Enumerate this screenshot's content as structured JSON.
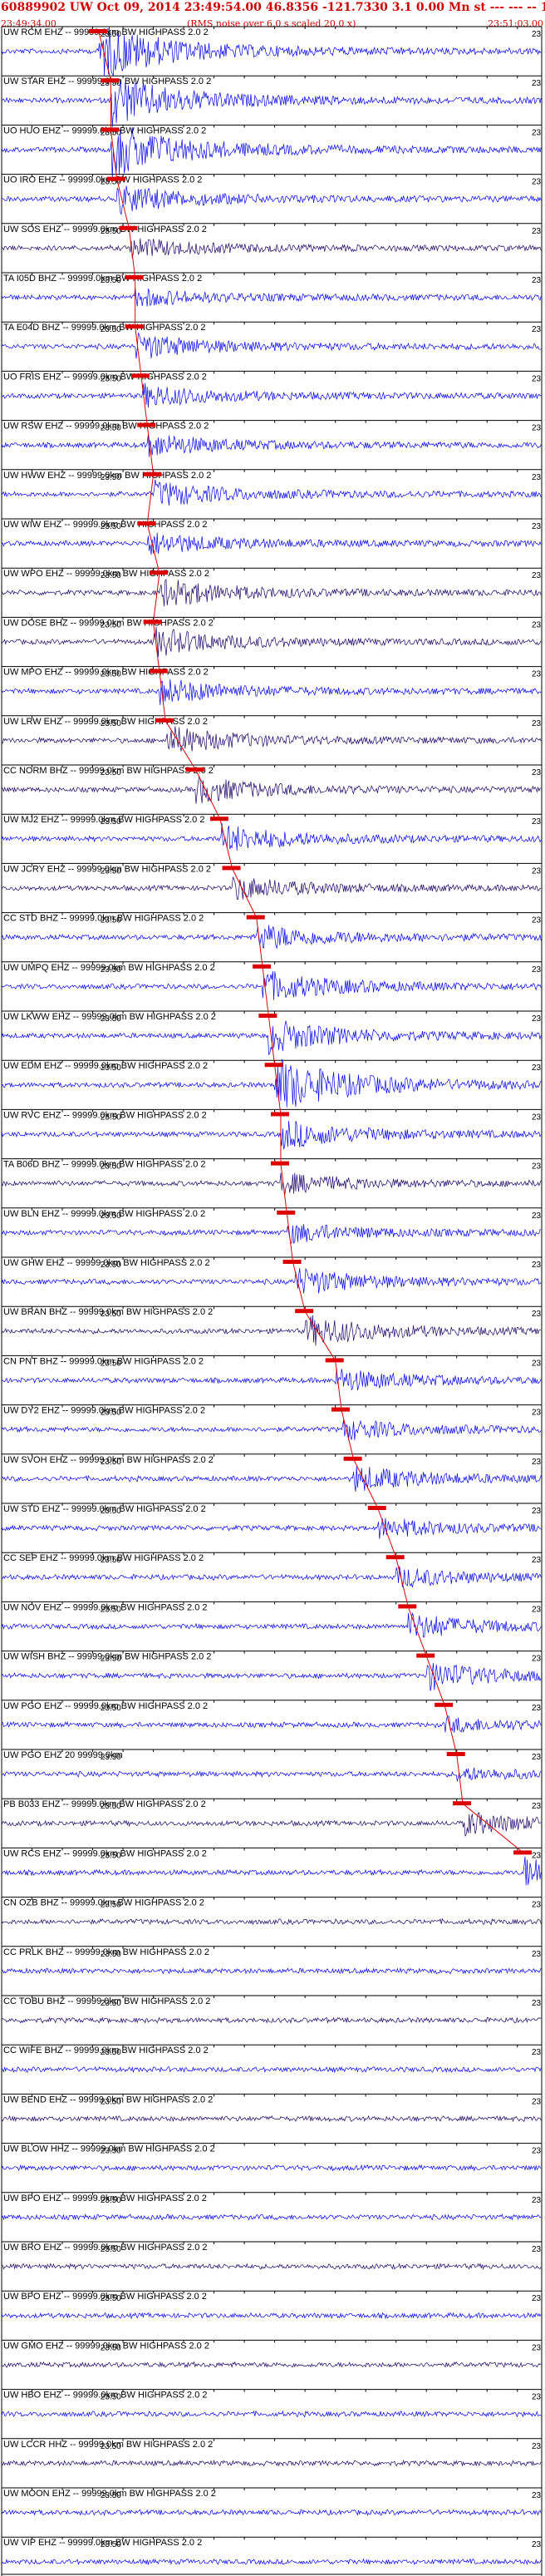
{
  "header": {
    "title": "60889902 UW Oct 09, 2014 23:49:54.00   46.8356 -121.7330  3.1 0.00 Mn st --- --- -- 1",
    "start_time": "23:49:34.00",
    "note": "(RMS noise over 6.0 s scaled 20.0 x)",
    "end_time": "23:51:03.00"
  },
  "chart_data": {
    "type": "line",
    "title": "60889902 UW Oct 09, 2014 23:49:54.00   46.8356 -121.7330  3.1 0.00 Mn st --- --- -- 1",
    "time_start": "23:49:34.00",
    "time_end": "23:51:03.00",
    "x_range_seconds": [
      0,
      89
    ],
    "tick_label": "23:50",
    "end_tick_label": "23",
    "grid": true,
    "colors": {
      "trace_primary": "#0000ee",
      "trace_dark": "#1a0066",
      "pick": "#dd0000",
      "header": "#d00000"
    },
    "traces": [
      {
        "label": "UW RCM EHZ -- 99999.0km BW  HIGHPASS  2.0  2",
        "pick": 16,
        "amp": 1.0,
        "color": "#0000ee"
      },
      {
        "label": "UW STAR EHZ -- 99999.0km BW  HIGHPASS  2.0  2",
        "pick": 18,
        "amp": 0.9,
        "color": "#0000ee"
      },
      {
        "label": "UO HUO EHZ -- 99999.0km BW  HIGHPASS  2.0  2",
        "pick": 18,
        "amp": 1.0,
        "color": "#0000ee"
      },
      {
        "label": "UO IRO EHZ -- 99999.0km BW  HIGHPASS  2.0  2",
        "pick": 19,
        "amp": 0.5,
        "color": "#0000ee"
      },
      {
        "label": "UW SOS EHZ -- 99999.0km BW  HIGHPASS  2.0  2",
        "pick": 21,
        "amp": 0.35,
        "color": "#1a0066"
      },
      {
        "label": "TA I05D BHZ -- 99999.0km BW  HIGHPASS  2.0  2",
        "pick": 22,
        "amp": 0.3,
        "color": "#0000ee"
      },
      {
        "label": "TA E04D BHZ -- 99999.0km BW  HIGHPASS  2.0  2",
        "pick": 22,
        "amp": 0.45,
        "color": "#0000ee"
      },
      {
        "label": "UO FRIS EHZ -- 99999.0km BW  HIGHPASS  2.0  2",
        "pick": 23,
        "amp": 0.4,
        "color": "#0000ee"
      },
      {
        "label": "UW RSW EHZ -- 99999.0km BW  HIGHPASS  2.0  2",
        "pick": 24,
        "amp": 0.4,
        "color": "#0000ee"
      },
      {
        "label": "UW HWW EHZ -- 99999.0km BW  HIGHPASS  2.0  2",
        "pick": 25,
        "amp": 0.45,
        "color": "#0000ee"
      },
      {
        "label": "UW WIW EHZ -- 99999.0km BW  HIGHPASS  2.0  2",
        "pick": 24,
        "amp": 0.4,
        "color": "#0000ee"
      },
      {
        "label": "UW WPO EHZ -- 99999.0km BW  HIGHPASS  2.0  2",
        "pick": 26,
        "amp": 0.5,
        "color": "#1a0066"
      },
      {
        "label": "UW DOSE BHZ -- 99999.0km BW  HIGHPASS  2.0  2",
        "pick": 25,
        "amp": 0.5,
        "color": "#1a0066"
      },
      {
        "label": "UW MPO EHZ -- 99999.0km BW  HIGHPASS  2.0  2",
        "pick": 26,
        "amp": 0.45,
        "color": "#0000ee"
      },
      {
        "label": "UW LRW EHZ -- 99999.0km BW  HIGHPASS  2.0  2",
        "pick": 27,
        "amp": 0.5,
        "color": "#1a0066"
      },
      {
        "label": "CC NORM BHZ -- 99999.0km BW  HIGHPASS  2.0  2",
        "pick": 32,
        "amp": 0.45,
        "color": "#1a0066"
      },
      {
        "label": "UW MJ2 EHZ -- 99999.0km BW  HIGHPASS  2.0  2",
        "pick": 36,
        "amp": 0.5,
        "color": "#0000ee"
      },
      {
        "label": "UW JCRY EHZ -- 99999.0km BW  HIGHPASS  2.0  2",
        "pick": 38,
        "amp": 0.4,
        "color": "#1a0066"
      },
      {
        "label": "CC STD BHZ -- 99999.0km BW  HIGHPASS  2.0  2",
        "pick": 42,
        "amp": 0.45,
        "color": "#0000ee"
      },
      {
        "label": "UW UMPQ EHZ -- 99999.0km BW  HIGHPASS  2.0  2",
        "pick": 43,
        "amp": 0.55,
        "color": "#0000ee"
      },
      {
        "label": "UW LKWW EHZ -- 99999.0km BW  HIGHPASS  2.0  2",
        "pick": 44,
        "amp": 0.6,
        "color": "#0000ee"
      },
      {
        "label": "UW EDM EHZ -- 99999.0km BW  HIGHPASS  2.0  2",
        "pick": 45,
        "amp": 1.0,
        "color": "#0000ee"
      },
      {
        "label": "UW RVC EHZ -- 99999.0km BW  HIGHPASS  2.0  2",
        "pick": 46,
        "amp": 0.5,
        "color": "#0000ee"
      },
      {
        "label": "TA B06D BHZ -- 99999.0km BW  HIGHPASS  2.0  2",
        "pick": 46,
        "amp": 0.35,
        "color": "#1a0066"
      },
      {
        "label": "UW BLN EHZ -- 99999.0km BW  HIGHPASS  2.0  2",
        "pick": 47,
        "amp": 0.35,
        "color": "#0000ee"
      },
      {
        "label": "UW GHW EHZ -- 99999.0km BW  HIGHPASS  2.0  2",
        "pick": 48,
        "amp": 0.5,
        "color": "#0000ee"
      },
      {
        "label": "UW BRAN BHZ -- 99999.0km BW  HIGHPASS  2.0  2",
        "pick": 50,
        "amp": 0.55,
        "color": "#1a0066"
      },
      {
        "label": "CN PNT BHZ -- 99999.0km BW  HIGHPASS  2.0  2",
        "pick": 55,
        "amp": 0.4,
        "color": "#0000ee"
      },
      {
        "label": "UW DY2 EHZ -- 99999.0km BW  HIGHPASS  2.0  2",
        "pick": 56,
        "amp": 0.35,
        "color": "#0000ee"
      },
      {
        "label": "UW SVOH EHZ -- 99999.0km BW  HIGHPASS  2.0  2",
        "pick": 58,
        "amp": 0.45,
        "color": "#0000ee"
      },
      {
        "label": "UW STD EHZ -- 99999.0km BW  HIGHPASS  2.0  2",
        "pick": 62,
        "amp": 0.35,
        "color": "#0000ee"
      },
      {
        "label": "CC SEP EHZ -- 99999.0km BW  HIGHPASS  2.0  2",
        "pick": 65,
        "amp": 0.35,
        "color": "#0000ee"
      },
      {
        "label": "UW NOV EHZ -- 99999.0km BW  HIGHPASS  2.0  2",
        "pick": 67,
        "amp": 0.45,
        "color": "#0000ee"
      },
      {
        "label": "UW WISH BHZ -- 99999.0km BW  HIGHPASS  2.0  2",
        "pick": 70,
        "amp": 0.5,
        "color": "#0000ee"
      },
      {
        "label": "UW PGO EHZ -- 99999.0km BW  HIGHPASS  2.0  2",
        "pick": 73,
        "amp": 0.25,
        "color": "#0000ee"
      },
      {
        "label": "UW PGO EHZ 20 99999.0km",
        "pick": 75,
        "amp": 0.2,
        "color": "#0000ee"
      },
      {
        "label": "PB B033 EHZ -- 99999.0km BW  HIGHPASS  2.0  2",
        "pick": 76,
        "amp": 0.4,
        "color": "#1a0066"
      },
      {
        "label": "UW RCS EHZ -- 99999.0km BW  HIGHPASS  2.0  2",
        "pick": 86,
        "amp": 0.55,
        "color": "#0000ee"
      },
      {
        "label": "CN OZB BHZ -- 99999.0km BW  HIGHPASS  2.0  2",
        "pick": null,
        "amp": 0.3,
        "color": "#1a0066"
      },
      {
        "label": "CC PRLK BHZ -- 99999.0km BW  HIGHPASS  2.0  2",
        "pick": null,
        "amp": 0.3,
        "color": "#0000ee"
      },
      {
        "label": "CC TOBU BHZ -- 99999.0km BW  HIGHPASS  2.0  2",
        "pick": null,
        "amp": 0.3,
        "color": "#1a0066"
      },
      {
        "label": "CC WIFE BHZ -- 99999.0km BW  HIGHPASS  2.0  2",
        "pick": null,
        "amp": 0.3,
        "color": "#0000ee"
      },
      {
        "label": "UW BEND EHZ -- 99999.0km BW  HIGHPASS  2.0  2",
        "pick": null,
        "amp": 0.3,
        "color": "#1a0066"
      },
      {
        "label": "UW BLOW HHZ -- 99999.0km BW  HIGHPASS  2.0  2",
        "pick": null,
        "amp": 0.3,
        "color": "#0000ee"
      },
      {
        "label": "UW BPO EHZ -- 99999.0km BW  HIGHPASS  2.0  2",
        "pick": null,
        "amp": 0.3,
        "color": "#0000ee"
      },
      {
        "label": "UW BRO EHZ -- 99999.0km BW  HIGHPASS  2.0  2",
        "pick": null,
        "amp": 0.3,
        "color": "#1a0066"
      },
      {
        "label": "UW BPO EHZ -- 99999.0km BW  HIGHPASS  2.0  2",
        "pick": null,
        "amp": 0.3,
        "color": "#0000ee"
      },
      {
        "label": "UW GMO EHZ -- 99999.0km BW  HIGHPASS  2.0  2",
        "pick": null,
        "amp": 0.3,
        "color": "#1a0066"
      },
      {
        "label": "UW HBO EHZ -- 99999.0km BW  HIGHPASS  2.0  2",
        "pick": null,
        "amp": 0.3,
        "color": "#0000ee"
      },
      {
        "label": "UW LCCR HHZ -- 99999.0km BW  HIGHPASS  2.0  2",
        "pick": null,
        "amp": 0.3,
        "color": "#1a0066"
      },
      {
        "label": "UW MOON EHZ -- 99999.0km BW  HIGHPASS  2.0  2",
        "pick": null,
        "amp": 0.3,
        "color": "#0000ee"
      },
      {
        "label": "UW VIP EHZ -- 99999.0km BW  HIGHPASS  2.0  2",
        "pick": null,
        "amp": 0.3,
        "color": "#0000ee"
      }
    ]
  }
}
